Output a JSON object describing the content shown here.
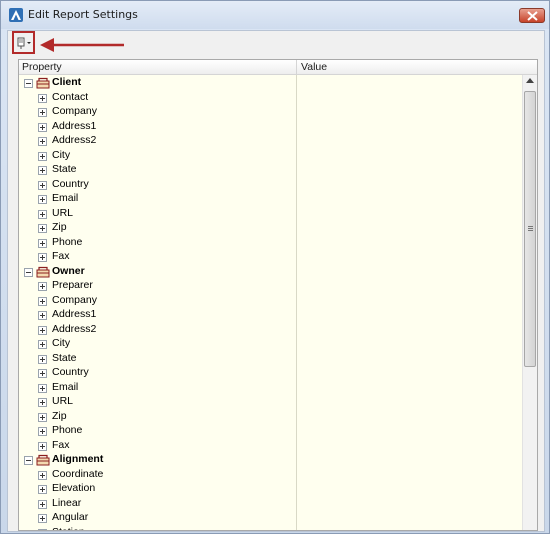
{
  "window": {
    "title": "Edit Report Settings",
    "close_icon": "close-icon",
    "accent_close": "#c7432a"
  },
  "toolbar": {
    "settings_icon": "property-dropdown-icon",
    "highlight_color": "#b22a2a"
  },
  "grid": {
    "columns": [
      "Property",
      "Value"
    ],
    "background": "#ffffef",
    "groups": [
      {
        "label": "Client",
        "items": [
          "Contact",
          "Company",
          "Address1",
          "Address2",
          "City",
          "State",
          "Country",
          "Email",
          "URL",
          "Zip",
          "Phone",
          "Fax"
        ]
      },
      {
        "label": "Owner",
        "items": [
          "Preparer",
          "Company",
          "Address1",
          "Address2",
          "City",
          "State",
          "Country",
          "Email",
          "URL",
          "Zip",
          "Phone",
          "Fax"
        ]
      },
      {
        "label": "Alignment",
        "items": [
          "Coordinate",
          "Elevation",
          "Linear",
          "Angular",
          "Station"
        ]
      }
    ]
  },
  "scrollbar": {
    "position_fraction": 0.0,
    "visible_fraction": 0.6
  }
}
